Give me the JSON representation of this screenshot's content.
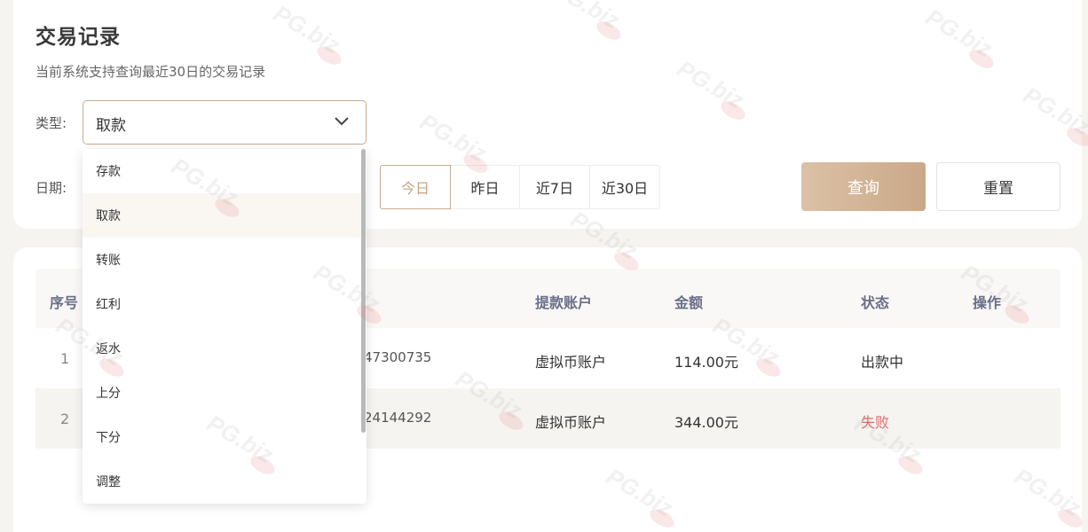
{
  "header": {
    "title": "交易记录",
    "subtitle": "当前系统支持查询最近30日的交易记录"
  },
  "filters": {
    "type_label": "类型:",
    "type_value": "取款",
    "date_label": "日期:",
    "ranges": [
      "今日",
      "昨日",
      "近7日",
      "近30日"
    ],
    "query_label": "查询",
    "reset_label": "重置"
  },
  "dropdown": {
    "options": [
      "存款",
      "取款",
      "转账",
      "红利",
      "返水",
      "上分",
      "下分",
      "调整"
    ],
    "selected": "取款"
  },
  "table": {
    "columns": [
      "序号",
      "提款账户",
      "金额",
      "状态",
      "操作"
    ],
    "rows": [
      {
        "index": "1",
        "order": "47300735",
        "account": "虚拟币账户",
        "amount": "114.00元",
        "status": "出款中"
      },
      {
        "index": "2",
        "order": "24144292",
        "account": "虚拟币账户",
        "amount": "344.00元",
        "status": "失败"
      }
    ]
  },
  "colors": {
    "accent": "#c9aa8a",
    "fail": "#e06a6a",
    "header_text": "#6a6e8a"
  },
  "icons": {
    "select_arrow": "chevron-down-icon"
  },
  "watermark": "PG.biz"
}
